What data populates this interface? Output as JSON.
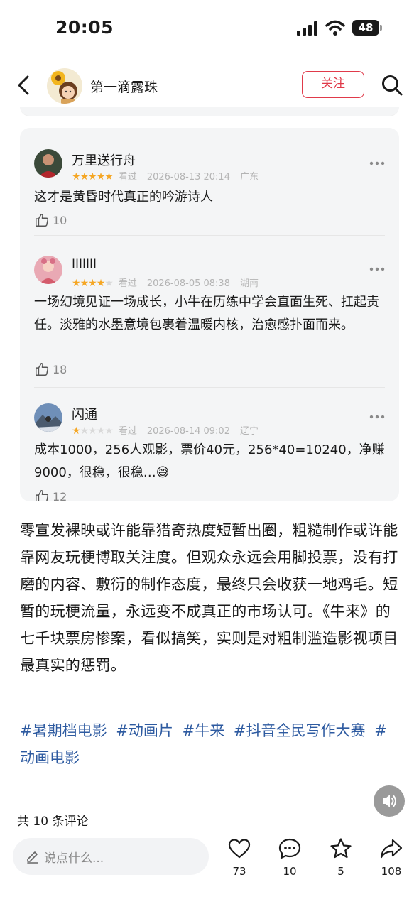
{
  "status_bar": {
    "time": "20:05",
    "battery": "48"
  },
  "header": {
    "author_name": "第一滴露珠",
    "follow_label": "关注"
  },
  "reviews": [
    {
      "name": "万里送行舟",
      "rating": 5,
      "watched": "看过",
      "datetime": "2026-08-13 20:14",
      "location": "广东",
      "text": "这才是黄昏时代真正的吟游诗人",
      "likes": "10"
    },
    {
      "name": "lllllll",
      "rating": 4,
      "watched": "看过",
      "datetime": "2026-08-05 08:38",
      "location": "湖南",
      "text": "一场幻境见证一场成长，小牛在历练中学会直面生死、扛起责任。淡雅的水墨意境包裹着温暖内核，治愈感扑面而来。",
      "likes": "18"
    },
    {
      "name": "闪通",
      "rating": 1,
      "watched": "看过",
      "datetime": "2026-08-14 09:02",
      "location": "辽宁",
      "text": "成本1000，256人观影，票价40元，256*40=10240，净赚9000，很稳，很稳…😅",
      "likes": "12"
    }
  ],
  "article": {
    "body": "零宣发裸映或许能靠猎奇热度短暂出圈，粗糙制作或许能靠网友玩梗博取关注度。但观众永远会用脚投票，没有打磨的内容、敷衍的制作态度，最终只会收获一地鸡毛。短暂的玩梗流量，永远变不成真正的市场认可。《牛来》的七千块票房惨案，看似搞笑，实则是对粗制滥造影视项目最真实的惩罚。",
    "tags": [
      "#暑期档电影",
      "#动画片",
      "#牛来",
      "#抖音全民写作大赛",
      "#动画电影"
    ]
  },
  "footer": {
    "comments_count": "共 10 条评论",
    "comment_placeholder": "说点什么...",
    "likes": "73",
    "comments": "10",
    "favorites": "5",
    "shares": "108"
  },
  "colors": {
    "accent_red": "#e03a4a",
    "tag_blue": "#2d5aa0",
    "star": "#f5a623"
  }
}
